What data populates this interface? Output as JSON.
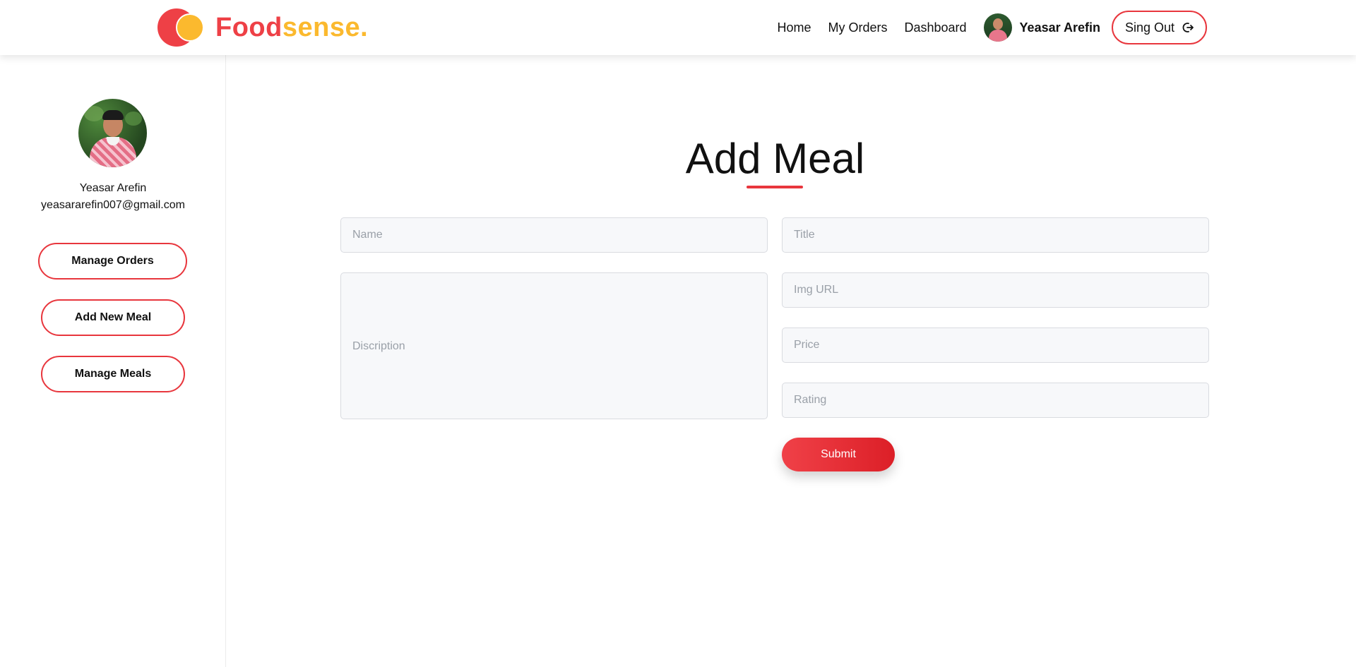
{
  "header": {
    "logo_part1": "Food",
    "logo_part2": "sense.",
    "nav": {
      "home": "Home",
      "my_orders": "My Orders",
      "dashboard": "Dashboard"
    },
    "user_name": "Yeasar Arefin",
    "signout_label": "Sing Out"
  },
  "sidebar": {
    "name": "Yeasar Arefin",
    "email": "yeasararefin007@gmail.com",
    "buttons": {
      "manage_orders": "Manage Orders",
      "add_new_meal": "Add New Meal",
      "manage_meals": "Manage Meals"
    }
  },
  "main": {
    "title": "Add Meal",
    "form": {
      "name_placeholder": "Name",
      "title_placeholder": "Title",
      "description_placeholder": "Discription",
      "img_url_placeholder": "Img URL",
      "price_placeholder": "Price",
      "rating_placeholder": "Rating",
      "submit_label": "Submit"
    }
  },
  "colors": {
    "brand_red": "#ee4046",
    "brand_yellow": "#fbb92e",
    "button_red": "#e8363d"
  }
}
